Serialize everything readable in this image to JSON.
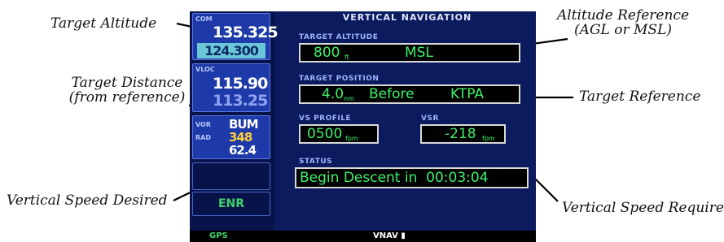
{
  "callouts": {
    "target_altitude": "Target Altitude",
    "target_distance_line1": "Target Distance",
    "target_distance_line2": "(from reference)",
    "vertical_speed_desired": "Vertical Speed Desired",
    "altitude_reference_line1": "Altitude Reference",
    "altitude_reference_line2": "(AGL or MSL)",
    "target_reference": "Target Reference",
    "vertical_speed_required": "Vertical Speed Required"
  },
  "radio_panel": {
    "com_label": "COM",
    "com_active": "135.325",
    "com_standby": "124.300",
    "vloc_label": "VLOC",
    "vloc_active": "115.90",
    "vloc_standby": "113.25",
    "vor_label": "VOR",
    "vor_ident": "BUM",
    "rad_label": "RAD",
    "radial": "348",
    "distance": "62.4",
    "mode": "ENR"
  },
  "vnav_page": {
    "title": "VERTICAL NAVIGATION",
    "target_altitude_label": "TARGET ALTITUDE",
    "target_altitude_value": "800",
    "target_altitude_unit": "ft",
    "altitude_reference": "MSL",
    "target_position_label": "TARGET POSITION",
    "target_distance": "4.0",
    "target_distance_unit": "nm",
    "position_relation": "Before",
    "target_waypoint": "KTPA",
    "vs_profile_label": "VS PROFILE",
    "vs_profile_value": "0500",
    "vs_profile_unit": "fpm",
    "vsr_label": "VSR",
    "vsr_value": "-218",
    "vsr_unit": "fpm",
    "status_label": "STATUS",
    "status_text": "Begin Descent in  00:03:04"
  },
  "status_bar": {
    "left": "GPS",
    "center": "VNAV"
  },
  "colors": {
    "screen_bg": "#0c1a5e",
    "field_text": "#3ef06a",
    "label_text": "#9fb3ff",
    "field_border": "#d8d8d8"
  }
}
